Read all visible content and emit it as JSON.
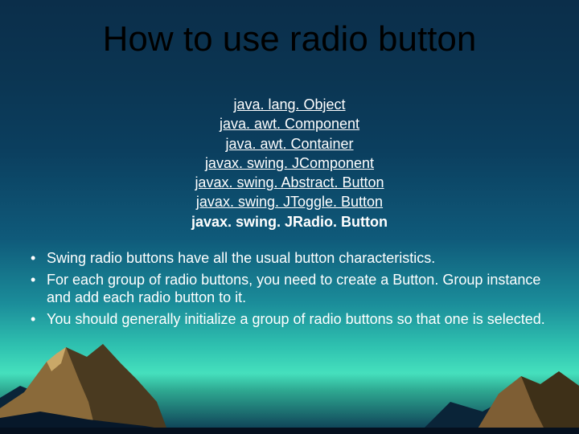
{
  "title": "How to use radio button",
  "hierarchy": {
    "items": [
      "java. lang. Object",
      "java. awt. Component",
      "java. awt. Container",
      "javax. swing. JComponent",
      "javax. swing. Abstract. Button",
      "javax. swing. JToggle. Button"
    ],
    "final": "javax. swing. JRadio. Button"
  },
  "bullets": [
    "Swing radio buttons have all the usual button characteristics.",
    "For each group of radio buttons, you need to create a Button. Group instance and add each radio button to it.",
    "You should generally initialize a group of radio buttons so that one is selected."
  ]
}
